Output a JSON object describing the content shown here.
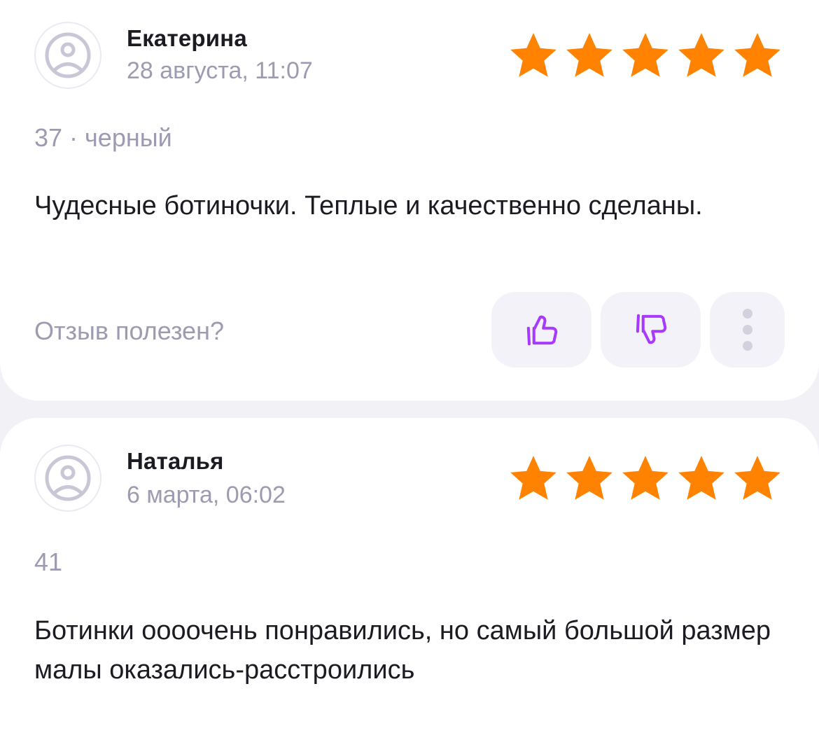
{
  "reviews": [
    {
      "author": "Екатерина",
      "date": "28 августа, 11:07",
      "rating": 5,
      "meta": "37 · черный",
      "text": "Чудесные ботиночки. Теплые и качественно сделаны.",
      "helpful_question": "Отзыв полезен?"
    },
    {
      "author": "Наталья",
      "date": "6 марта, 06:02",
      "rating": 5,
      "meta": "41",
      "text": "Ботинки оооочень понравились, но самый большой размер малы оказались-расстроились"
    }
  ],
  "colors": {
    "star": "#ff8200",
    "accent": "#a73afd",
    "muted_text": "#9d9bb0",
    "button_bg": "#f3f2f8"
  },
  "icons": {
    "avatar": "sad-face-icon",
    "like": "thumbs-up-icon",
    "dislike": "thumbs-down-icon",
    "more": "more-vertical-icon"
  }
}
